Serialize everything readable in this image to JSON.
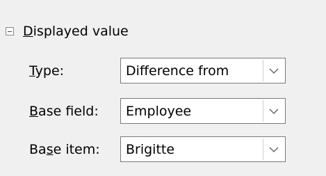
{
  "section": {
    "title": "Displayed value",
    "title_access_char": "D",
    "title_rest": "isplayed value"
  },
  "rows": [
    {
      "label_pre": "",
      "label_access": "T",
      "label_post": "ype:",
      "value": "Difference from"
    },
    {
      "label_pre": "",
      "label_access": "B",
      "label_post": "ase field:",
      "value": "Employee"
    },
    {
      "label_pre": "Ba",
      "label_access": "s",
      "label_post": "e item:",
      "value": "Brigitte"
    }
  ],
  "icons": {
    "collapse": "minus-box-icon",
    "dropdown": "chevron-down-icon"
  }
}
